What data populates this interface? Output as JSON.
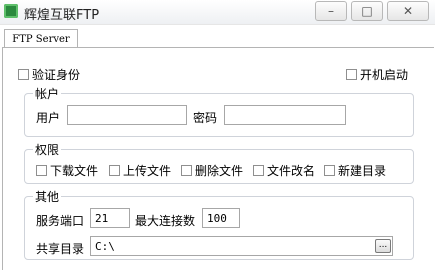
{
  "window": {
    "title": "辉煌互联FTP"
  },
  "titlebar": {
    "minimize": "–",
    "restore": "□",
    "close": "✕"
  },
  "tab": {
    "label": "FTP Server"
  },
  "options": {
    "auth_label": "验证身份",
    "autostart_label": "开机启动"
  },
  "account": {
    "title": "帐户",
    "user_label": "用户",
    "user_value": "",
    "password_label": "密码",
    "password_value": ""
  },
  "permissions": {
    "title": "权限",
    "items": [
      "下载文件",
      "上传文件",
      "删除文件",
      "文件改名",
      "新建目录"
    ]
  },
  "other": {
    "title": "其他",
    "port_label": "服务端口",
    "port_value": "21",
    "maxconn_label": "最大连接数",
    "maxconn_value": "100",
    "share_label": "共享目录",
    "share_value": "C:\\",
    "browse_label": "..."
  }
}
